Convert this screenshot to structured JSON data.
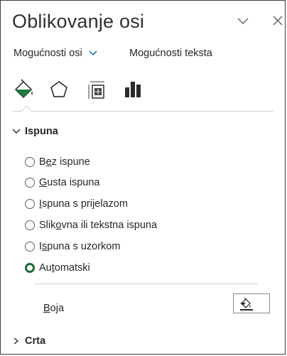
{
  "pane": {
    "title": "Oblikovanje osi",
    "menu_icon": "chevron-down-icon",
    "close_icon": "close-icon"
  },
  "options": {
    "axis_options_label": "Mogućnosti osi",
    "text_options_label": "Mogućnosti teksta"
  },
  "tabs": [
    {
      "name": "fill-line-icon",
      "selected": true
    },
    {
      "name": "effects-icon",
      "selected": false
    },
    {
      "name": "size-properties-icon",
      "selected": false
    },
    {
      "name": "axis-options-icon",
      "selected": false
    }
  ],
  "fill": {
    "heading": "Ispuna",
    "options": [
      {
        "pre": "B",
        "ul": "e",
        "post": "z ispune",
        "selected": false
      },
      {
        "pre": "",
        "ul": "G",
        "post": "usta ispuna",
        "selected": false
      },
      {
        "pre": "",
        "ul": "I",
        "post": "spuna s prijelazom",
        "selected": false
      },
      {
        "pre": "Slik",
        "ul": "o",
        "post": "vna ili tekstna ispuna",
        "selected": false
      },
      {
        "pre": "I",
        "ul": "s",
        "post": "puna s uzorkom",
        "selected": false
      },
      {
        "pre": "Au",
        "ul": "t",
        "post": "omatski",
        "selected": true
      }
    ],
    "color_label_ul": "B",
    "color_label_rest": "oja"
  },
  "line": {
    "heading": "Crta"
  },
  "colors": {
    "accent_green": "#1e6b36",
    "selected_underline": "#c8c8c8"
  }
}
